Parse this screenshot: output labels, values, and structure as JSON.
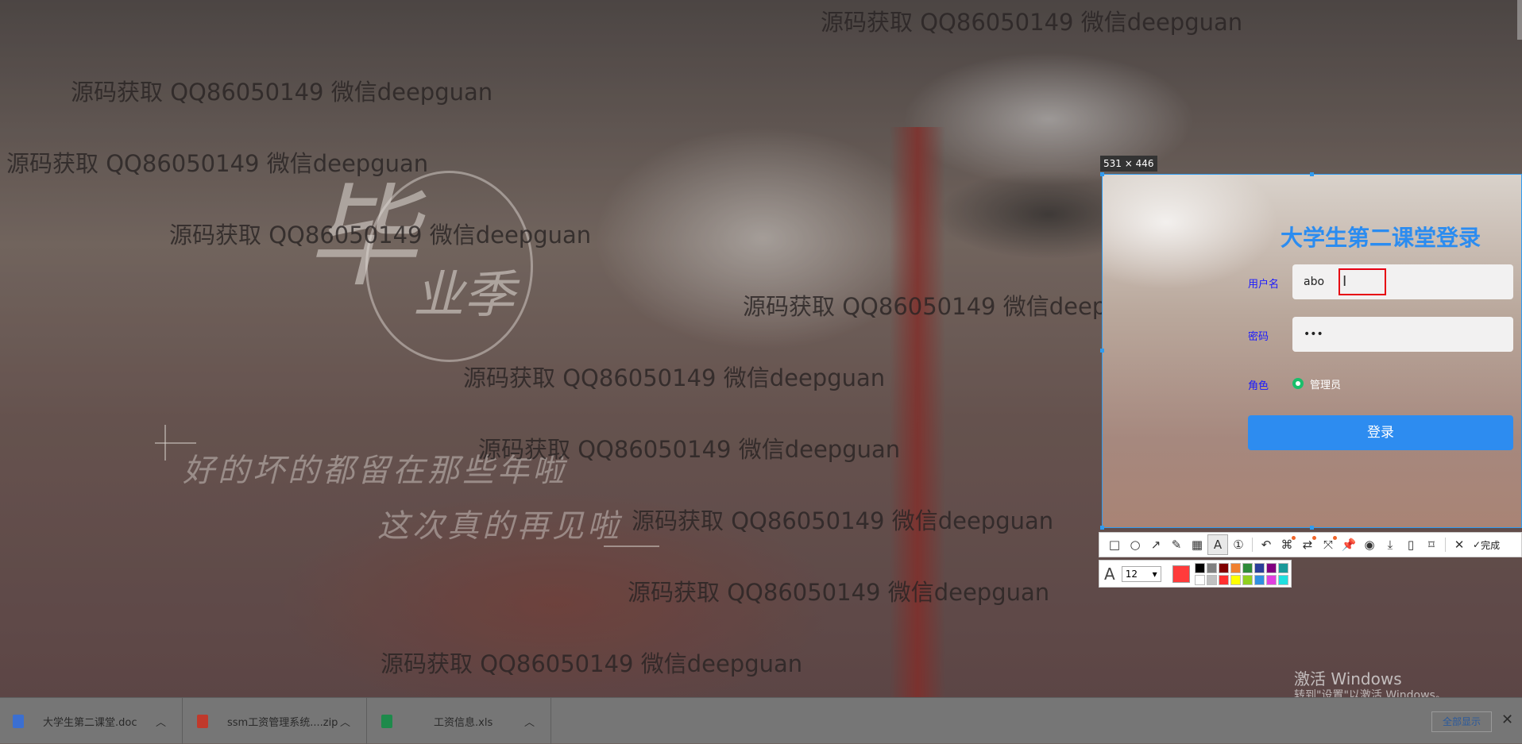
{
  "background": {
    "calligraphy_big": "毕",
    "calligraphy_small": "业季",
    "poem_line1": "好的坏的都留在那些年啦",
    "poem_line2": "这次真的再见啦"
  },
  "watermarks": [
    "源码获取 QQ86050149 微信deepguan",
    "源码获取 QQ86050149 微信deepguan",
    "源码获取 QQ86050149 微信deepguan",
    "源码获取 QQ86050149 微信deepguan",
    "源码获取 QQ86050149 微信deepguan",
    "源码获取 QQ86050149 微信deepguan",
    "源码获取 QQ86050149 微信deepguan",
    "源码获取 QQ86050149 微信deepguan",
    "源码获取 QQ86050149 微信deepguan",
    "源码获取 QQ86050149 微信deepguan"
  ],
  "selection": {
    "size_label": "531 × 446"
  },
  "login": {
    "title": "大学生第二课堂登录",
    "username_label": "用户名",
    "username_value": "abo",
    "password_label": "密码",
    "password_value": "•••",
    "role_label": "角色",
    "role_option": "管理员",
    "login_button": "登录"
  },
  "toolbar": {
    "tools": [
      "rectangle-icon",
      "ellipse-icon",
      "arrow-icon",
      "pencil-icon",
      "mosaic-icon",
      "text-icon",
      "number-icon",
      "undo-icon",
      "ocr-icon",
      "translate-icon",
      "scroll-capture-icon",
      "pin-icon",
      "record-icon",
      "download-icon",
      "save-icon",
      "bookmark-icon",
      "close-icon"
    ],
    "done_label": "完成",
    "font_size": "12",
    "current_color": "#ff3b3b",
    "palette": [
      "#000000",
      "#808080",
      "#800000",
      "#f08030",
      "#2e8b3a",
      "#2a3f9a",
      "#800080",
      "#1a9a9a",
      "#ffffff",
      "#c0c0c0",
      "#ff3030",
      "#ffff00",
      "#90d020",
      "#3090e0",
      "#e040e0",
      "#20e0e0"
    ]
  },
  "activate_windows": {
    "title": "激活 Windows",
    "subtitle": "转到\"设置\"以激活 Windows。"
  },
  "downloads": {
    "items": [
      {
        "name": "大学生第二课堂.doc",
        "icon_color": "#3b6fd1"
      },
      {
        "name": "ssm工资管理系统....zip",
        "icon_color": "#c0392b"
      },
      {
        "name": "工资信息.xls",
        "icon_color": "#1e8a4b"
      }
    ],
    "show_all": "全部显示",
    "close": "✕"
  }
}
